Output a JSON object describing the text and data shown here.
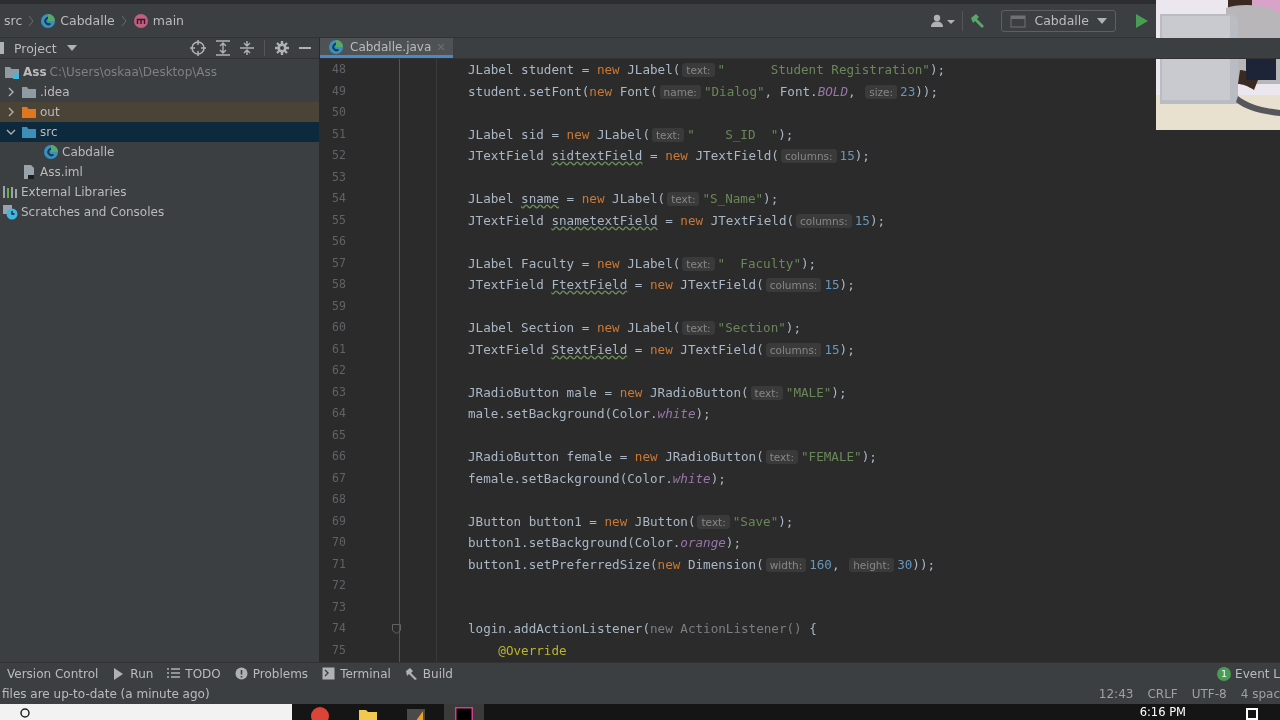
{
  "breadcrumb": [
    {
      "label": "src",
      "kind": "plain"
    },
    {
      "label": "Cabdalle",
      "kind": "class"
    },
    {
      "label": "main",
      "kind": "method"
    }
  ],
  "toolbar": {
    "run_config": "Cabdalle"
  },
  "project_panel": {
    "title": "Project",
    "tree": [
      {
        "label": "Ass",
        "detail": "C:\\Users\\oskaa\\Desktop\\Ass",
        "kind": "module",
        "selected": false,
        "children": [
          {
            "label": ".idea",
            "kind": "folder",
            "expanded": false,
            "selected": false
          },
          {
            "label": "out",
            "kind": "excluded",
            "expanded": false,
            "selected": false
          },
          {
            "label": "src",
            "kind": "source",
            "expanded": true,
            "selected": true,
            "children": [
              {
                "label": "Cabdalle",
                "kind": "class",
                "selected": false
              }
            ]
          },
          {
            "label": "Ass.iml",
            "kind": "file",
            "selected": false
          }
        ]
      },
      {
        "label": "External Libraries",
        "kind": "libraries",
        "selected": false
      },
      {
        "label": "Scratches and Consoles",
        "kind": "scratches",
        "selected": false
      }
    ]
  },
  "editor": {
    "tabs": [
      {
        "label": "Cabdalle.java",
        "selected": true
      }
    ],
    "lines": [
      {
        "number": "48",
        "tokens": [
          {
            "kind": "t",
            "text": "JLabel student = "
          },
          {
            "kind": "kw",
            "text": "new"
          },
          {
            "kind": "t",
            "text": " JLabel("
          },
          {
            "kind": "hint",
            "text": "text:"
          },
          {
            "kind": "str",
            "text": "\"      Student Registration\""
          },
          {
            "kind": "t",
            "text": ");"
          }
        ]
      },
      {
        "number": "49",
        "tokens": [
          {
            "kind": "t",
            "text": "student.setFont("
          },
          {
            "kind": "kw",
            "text": "new"
          },
          {
            "kind": "t",
            "text": " Font("
          },
          {
            "kind": "hint",
            "text": "name:"
          },
          {
            "kind": "str",
            "text": "\"Dialog\""
          },
          {
            "kind": "t",
            "text": ", Font."
          },
          {
            "kind": "field",
            "text": "BOLD"
          },
          {
            "kind": "t",
            "text": ", "
          },
          {
            "kind": "hint",
            "text": "size:"
          },
          {
            "kind": "num",
            "text": "23"
          },
          {
            "kind": "t",
            "text": "));"
          }
        ]
      },
      {
        "number": "50"
      },
      {
        "number": "51",
        "tokens": [
          {
            "kind": "t",
            "text": "JLabel sid = "
          },
          {
            "kind": "kw",
            "text": "new"
          },
          {
            "kind": "t",
            "text": " JLabel("
          },
          {
            "kind": "hint",
            "text": "text:"
          },
          {
            "kind": "str",
            "text": "\"    S_ID  \""
          },
          {
            "kind": "t",
            "text": ");"
          }
        ]
      },
      {
        "number": "52",
        "tokens": [
          {
            "kind": "t",
            "text": "JTextField "
          },
          {
            "kind": "typo",
            "text": "sidtextField"
          },
          {
            "kind": "t",
            "text": " = "
          },
          {
            "kind": "kw",
            "text": "new"
          },
          {
            "kind": "t",
            "text": " JTextField("
          },
          {
            "kind": "hint",
            "text": "columns:"
          },
          {
            "kind": "num",
            "text": "15"
          },
          {
            "kind": "t",
            "text": ");"
          }
        ]
      },
      {
        "number": "53"
      },
      {
        "number": "54",
        "tokens": [
          {
            "kind": "t",
            "text": "JLabel "
          },
          {
            "kind": "typo",
            "text": "sname"
          },
          {
            "kind": "t",
            "text": " = "
          },
          {
            "kind": "kw",
            "text": "new"
          },
          {
            "kind": "t",
            "text": " JLabel("
          },
          {
            "kind": "hint",
            "text": "text:"
          },
          {
            "kind": "str",
            "text": "\"S_Name\""
          },
          {
            "kind": "t",
            "text": ");"
          }
        ]
      },
      {
        "number": "55",
        "tokens": [
          {
            "kind": "t",
            "text": "JTextField "
          },
          {
            "kind": "typo",
            "text": "snametextField"
          },
          {
            "kind": "t",
            "text": " = "
          },
          {
            "kind": "kw",
            "text": "new"
          },
          {
            "kind": "t",
            "text": " JTextField("
          },
          {
            "kind": "hint",
            "text": "columns:"
          },
          {
            "kind": "num",
            "text": "15"
          },
          {
            "kind": "t",
            "text": ");"
          }
        ]
      },
      {
        "number": "56"
      },
      {
        "number": "57",
        "tokens": [
          {
            "kind": "t",
            "text": "JLabel Faculty = "
          },
          {
            "kind": "kw",
            "text": "new"
          },
          {
            "kind": "t",
            "text": " JLabel("
          },
          {
            "kind": "hint",
            "text": "text:"
          },
          {
            "kind": "str",
            "text": "\"  Faculty\""
          },
          {
            "kind": "t",
            "text": ");"
          }
        ]
      },
      {
        "number": "58",
        "tokens": [
          {
            "kind": "t",
            "text": "JTextField "
          },
          {
            "kind": "typo",
            "text": "FtextField"
          },
          {
            "kind": "t",
            "text": " = "
          },
          {
            "kind": "kw",
            "text": "new"
          },
          {
            "kind": "t",
            "text": " JTextField("
          },
          {
            "kind": "hint",
            "text": "columns:"
          },
          {
            "kind": "num",
            "text": "15"
          },
          {
            "kind": "t",
            "text": ");"
          }
        ]
      },
      {
        "number": "59"
      },
      {
        "number": "60",
        "tokens": [
          {
            "kind": "t",
            "text": "JLabel Section = "
          },
          {
            "kind": "kw",
            "text": "new"
          },
          {
            "kind": "t",
            "text": " JLabel("
          },
          {
            "kind": "hint",
            "text": "text:"
          },
          {
            "kind": "str",
            "text": "\"Section\""
          },
          {
            "kind": "t",
            "text": ");"
          }
        ]
      },
      {
        "number": "61",
        "tokens": [
          {
            "kind": "t",
            "text": "JTextField "
          },
          {
            "kind": "typo",
            "text": "StextField"
          },
          {
            "kind": "t",
            "text": " = "
          },
          {
            "kind": "kw",
            "text": "new"
          },
          {
            "kind": "t",
            "text": " JTextField("
          },
          {
            "kind": "hint",
            "text": "columns:"
          },
          {
            "kind": "num",
            "text": "15"
          },
          {
            "kind": "t",
            "text": ");"
          }
        ]
      },
      {
        "number": "62"
      },
      {
        "number": "63",
        "tokens": [
          {
            "kind": "t",
            "text": "JRadioButton male = "
          },
          {
            "kind": "kw",
            "text": "new"
          },
          {
            "kind": "t",
            "text": " JRadioButton("
          },
          {
            "kind": "hint",
            "text": "text:"
          },
          {
            "kind": "str",
            "text": "\"MALE\""
          },
          {
            "kind": "t",
            "text": ");"
          }
        ]
      },
      {
        "number": "64",
        "tokens": [
          {
            "kind": "t",
            "text": "male.setBackground(Color."
          },
          {
            "kind": "field",
            "text": "white"
          },
          {
            "kind": "t",
            "text": ");"
          }
        ]
      },
      {
        "number": "65"
      },
      {
        "number": "66",
        "tokens": [
          {
            "kind": "t",
            "text": "JRadioButton female = "
          },
          {
            "kind": "kw",
            "text": "new"
          },
          {
            "kind": "t",
            "text": " JRadioButton("
          },
          {
            "kind": "hint",
            "text": "text:"
          },
          {
            "kind": "str",
            "text": "\"FEMALE\""
          },
          {
            "kind": "t",
            "text": ");"
          }
        ]
      },
      {
        "number": "67",
        "tokens": [
          {
            "kind": "t",
            "text": "female.setBackground(Color."
          },
          {
            "kind": "field",
            "text": "white"
          },
          {
            "kind": "t",
            "text": ");"
          }
        ]
      },
      {
        "number": "68"
      },
      {
        "number": "69",
        "tokens": [
          {
            "kind": "t",
            "text": "JButton button1 = "
          },
          {
            "kind": "kw",
            "text": "new"
          },
          {
            "kind": "t",
            "text": " JButton("
          },
          {
            "kind": "hint",
            "text": "text:"
          },
          {
            "kind": "str",
            "text": "\"Save\""
          },
          {
            "kind": "t",
            "text": ");"
          }
        ]
      },
      {
        "number": "70",
        "tokens": [
          {
            "kind": "t",
            "text": "button1.setBackground(Color."
          },
          {
            "kind": "field",
            "text": "orange"
          },
          {
            "kind": "t",
            "text": ");"
          }
        ]
      },
      {
        "number": "71",
        "tokens": [
          {
            "kind": "t",
            "text": "button1.setPreferredSize("
          },
          {
            "kind": "kw",
            "text": "new"
          },
          {
            "kind": "t",
            "text": " Dimension("
          },
          {
            "kind": "hint",
            "text": "width:"
          },
          {
            "kind": "num",
            "text": "160"
          },
          {
            "kind": "t",
            "text": ", "
          },
          {
            "kind": "hint",
            "text": "height:"
          },
          {
            "kind": "num",
            "text": "30"
          },
          {
            "kind": "t",
            "text": "));"
          }
        ]
      },
      {
        "number": "72"
      },
      {
        "number": "73"
      },
      {
        "number": "74",
        "fold": true,
        "tokens": [
          {
            "kind": "t",
            "text": "login.addActionListener("
          },
          {
            "kind": "dim",
            "text": "new ActionListener()"
          },
          {
            "kind": "t",
            "text": " {"
          }
        ]
      },
      {
        "number": "75",
        "tokens": [
          {
            "kind": "ann",
            "text": "@Override"
          }
        ]
      }
    ]
  },
  "tool_windows": [
    {
      "label": "Version Control",
      "kind": "vcs"
    },
    {
      "label": "Run",
      "kind": "run"
    },
    {
      "label": "TODO",
      "kind": "todo"
    },
    {
      "label": "Problems",
      "kind": "problems"
    },
    {
      "label": "Terminal",
      "kind": "terminal"
    },
    {
      "label": "Build",
      "kind": "build"
    }
  ],
  "event_log": {
    "count": "1",
    "label": "Event L"
  },
  "status_bar": {
    "message": "files are up-to-date (a minute ago)",
    "items": [
      "12:43",
      "CRLF",
      "UTF-8",
      "4 spac"
    ]
  },
  "taskbar": {
    "apps": [
      {
        "kind": "browser",
        "selected": false
      },
      {
        "kind": "folder",
        "selected": false
      },
      {
        "kind": "app",
        "selected": false
      },
      {
        "kind": "ide",
        "selected": true
      }
    ],
    "clock": "6:16 PM"
  }
}
